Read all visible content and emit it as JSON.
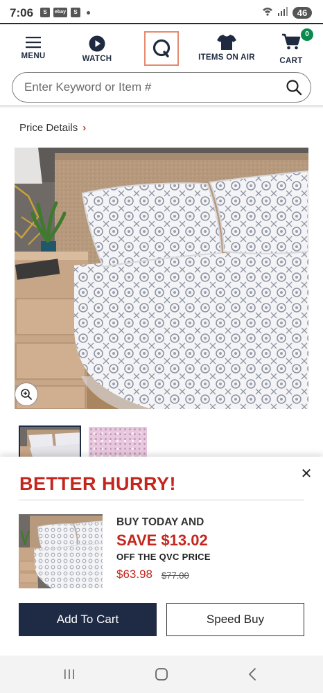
{
  "status_bar": {
    "time": "7:06",
    "app_icons": [
      "S",
      "ebay",
      "S"
    ],
    "battery": "46",
    "signal_label": "6"
  },
  "header": {
    "menu_label": "MENU",
    "watch_label": "WATCH",
    "logo": "Q",
    "items_on_air_label": "ITEMS ON AIR",
    "cart_label": "CART",
    "cart_count": "0"
  },
  "search": {
    "placeholder": "Enter Keyword or Item #"
  },
  "price_details": {
    "label": "Price Details",
    "chevron": "›"
  },
  "promo_sheet": {
    "title": "BETTER HURRY!",
    "close": "✕",
    "buy_today": "BUY TODAY AND",
    "save_text": "SAVE $13.02",
    "off_text": "OFF THE QVC PRICE",
    "price": "$63.98",
    "original_price": "$77.00"
  },
  "actions": {
    "add_to_cart": "Add To Cart",
    "speed_buy": "Speed Buy"
  },
  "colors": {
    "accent_red": "#c4261d",
    "navy": "#1f2b45",
    "badge_green": "#0a8a4e",
    "logo_border": "#e58a6d"
  }
}
